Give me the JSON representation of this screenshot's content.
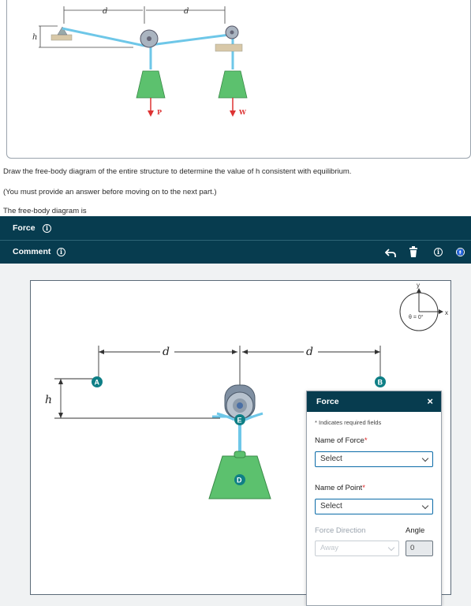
{
  "top_figure": {
    "dim_d1": "d",
    "dim_d2": "d",
    "dim_h": "h",
    "load_p": "P",
    "load_w": "W"
  },
  "instructions": {
    "main": "Draw the free-body diagram of the entire structure to determine the value of  h consistent with equilibrium.",
    "note": "(You must provide an answer before moving on to the next part.)",
    "fbd_label": "The free-body diagram is"
  },
  "toolbar": {
    "force_label": "Force",
    "comment_label": "Comment",
    "icons": [
      "undo-icon",
      "trash-icon",
      "info-icon",
      "accessibility-icon"
    ]
  },
  "diagram": {
    "dim_d1": "d",
    "dim_d2": "d",
    "dim_h": "h",
    "point_a": "A",
    "point_b": "B",
    "point_e": "E",
    "point_d": "D",
    "axis_x": "x",
    "axis_y": "y",
    "theta": "θ = 0°"
  },
  "force_panel": {
    "title": "Force",
    "close": "×",
    "required_note": "* Indicates required fields",
    "name_of_force_label": "Name of Force",
    "name_of_force_value": "Select",
    "name_of_point_label": "Name of Point",
    "name_of_point_value": "Select",
    "direction_label": "Force Direction",
    "direction_value": "Away",
    "angle_label": "Angle",
    "angle_value": "0",
    "required_star": "*"
  },
  "colors": {
    "toolbar_bg": "#073c4f",
    "teal_marker": "#0f7f86",
    "weight_green": "#5cc16e",
    "cable_blue": "#6ec7e8"
  }
}
